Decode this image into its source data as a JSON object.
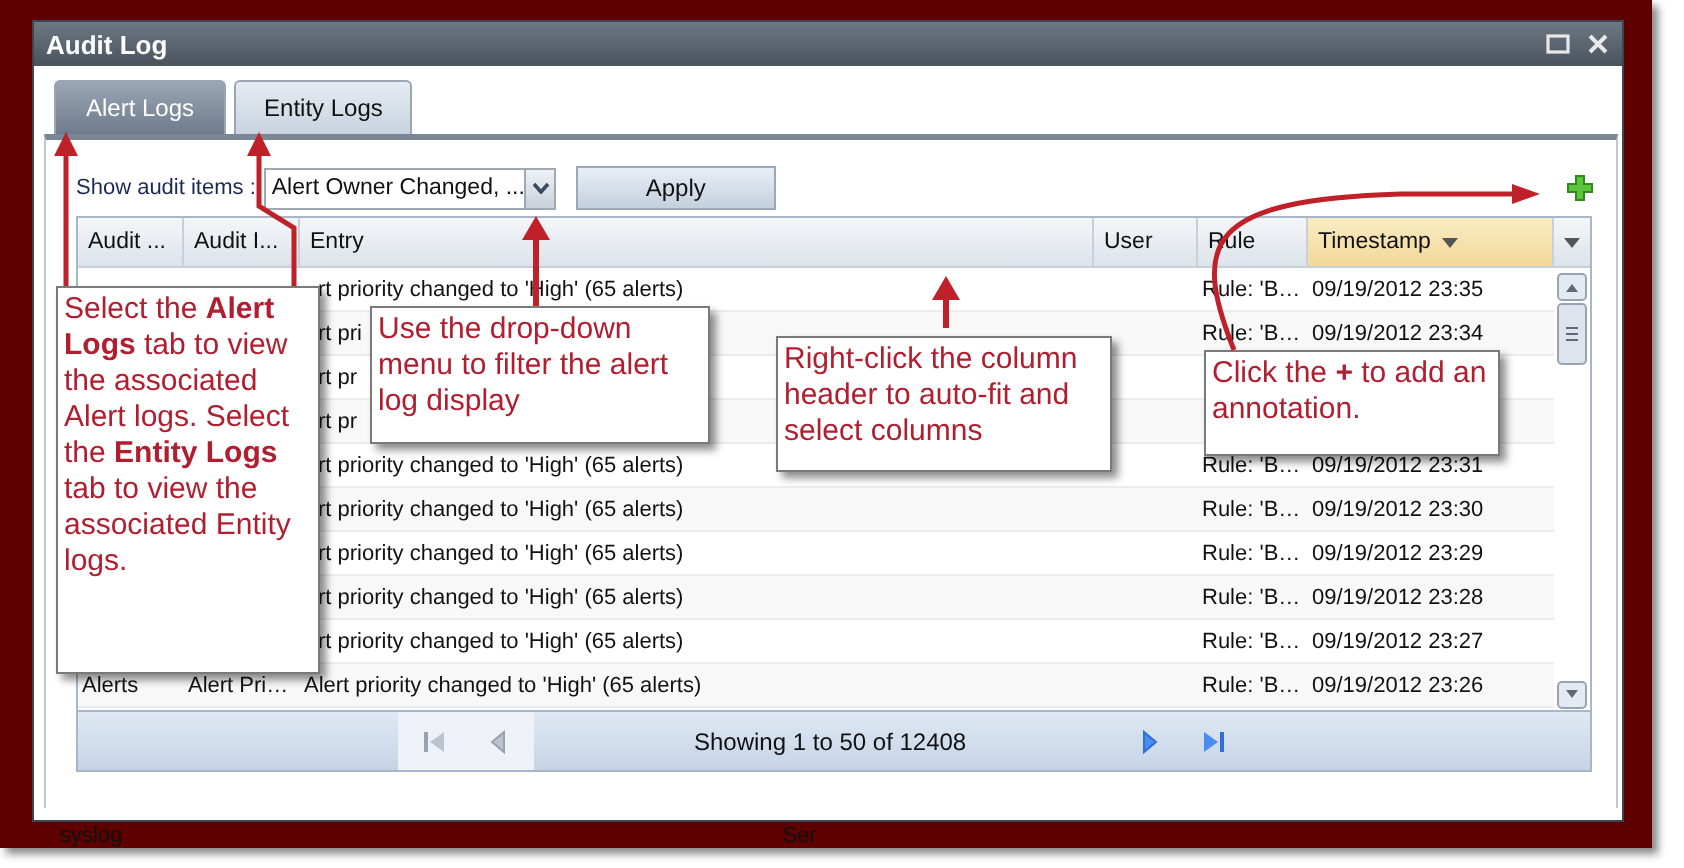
{
  "window": {
    "title": "Audit Log"
  },
  "tabs": [
    {
      "label": "Alert Logs",
      "selected": true
    },
    {
      "label": "Entity Logs",
      "selected": false
    }
  ],
  "filter": {
    "label": "Show audit items :",
    "value": "Alert Owner Changed, ...",
    "button": "Apply"
  },
  "table": {
    "columns": [
      {
        "label": "Audit ...",
        "sorted": false
      },
      {
        "label": "Audit I...",
        "sorted": false
      },
      {
        "label": "Entry",
        "sorted": false
      },
      {
        "label": "User",
        "sorted": false
      },
      {
        "label": "Rule",
        "sorted": false
      },
      {
        "label": "Timestamp",
        "sorted": true
      }
    ],
    "rows": [
      {
        "entry": "rt priority changed to 'High' (65 alerts)",
        "rule": "Rule: 'B…",
        "timestamp": "09/19/2012 23:35"
      },
      {
        "entry": "rt pri",
        "rule": "Rule: 'B…",
        "timestamp": "09/19/2012 23:34"
      },
      {
        "entry": "rt pr"
      },
      {
        "entry": "rt pr"
      },
      {
        "entry": "rt priority changed to 'High' (65 alerts)",
        "rule": "Rule: 'B…",
        "timestamp": "09/19/2012 23:31"
      },
      {
        "entry": "rt priority changed to 'High' (65 alerts)",
        "rule": "Rule: 'B…",
        "timestamp": "09/19/2012 23:30"
      },
      {
        "entry": "rt priority changed to 'High' (65 alerts)",
        "rule": "Rule: 'B…",
        "timestamp": "09/19/2012 23:29"
      },
      {
        "entry": "rt priority changed to 'High' (65 alerts)",
        "rule": "Rule: 'B…",
        "timestamp": "09/19/2012 23:28"
      },
      {
        "entry": "rt priority changed to 'High' (65 alerts)",
        "rule": "Rule: 'B…",
        "timestamp": "09/19/2012 23:27"
      },
      {
        "column_1": "Alerts",
        "column_2": "Alert Pri…",
        "entry": "Alert priority changed to 'High' (65 alerts)",
        "rule": "Rule: 'B…",
        "timestamp": "09/19/2012 23:26"
      }
    ]
  },
  "pager": {
    "status": "Showing 1 to 50 of 12408",
    "buttons": [
      {
        "kind": "first",
        "disabled": true
      },
      {
        "kind": "prev",
        "disabled": true
      },
      {
        "kind": "next",
        "disabled": false
      },
      {
        "kind": "last",
        "disabled": false
      }
    ]
  },
  "callouts": [
    "Select the **Alert Logs** tab to view the associated Alert logs. Select the **Entity Logs** tab to view the associated Entity logs.",
    "Use the drop-down menu to filter the alert log display",
    "Right-click the column header to auto-fit and select columns",
    "Click the **+** to add an annotation."
  ],
  "background_texts": [
    "syslog",
    "Ser"
  ]
}
